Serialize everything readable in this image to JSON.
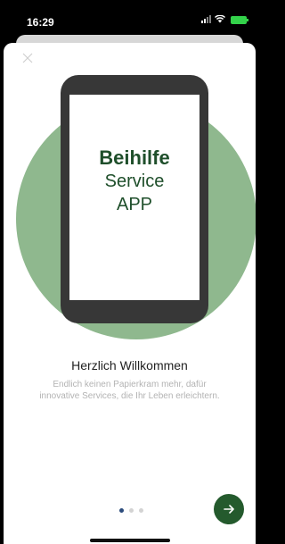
{
  "status_bar": {
    "time": "16:29"
  },
  "phone_screen": {
    "line1": "Beihilfe",
    "line2": "Service",
    "line3": "APP"
  },
  "onboarding": {
    "title": "Herzlich Willkommen",
    "text": "Endlich keinen Papierkram mehr, dafür innovative Services, die Ihr Leben erleichtern.",
    "current_page": 1,
    "total_pages": 3
  },
  "colors": {
    "accent": "#245a2d",
    "circle": "#8fb88e",
    "active_dot": "#2c4c7c"
  },
  "icons": {
    "close": "close-icon",
    "next": "arrow-right-icon"
  }
}
